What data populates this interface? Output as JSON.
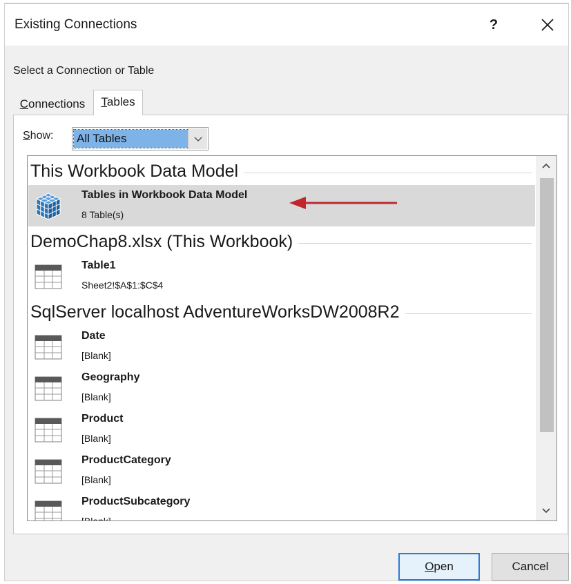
{
  "window": {
    "title": "Existing Connections",
    "help_label": "?",
    "close_label": "✕"
  },
  "prompt": "Select a Connection or Table",
  "tabs": [
    {
      "label_prefix": "",
      "label_underline": "C",
      "label_rest": "onnections",
      "active": false
    },
    {
      "label_prefix": "",
      "label_underline": "T",
      "label_rest": "ables",
      "active": true
    }
  ],
  "show": {
    "label_underline": "S",
    "label_rest": "how:",
    "value": "All Tables"
  },
  "groups": [
    {
      "header": "This Workbook Data Model",
      "items": [
        {
          "name": "Tables in Workbook Data Model",
          "sub": "8 Table(s)",
          "icon": "data-model-cube-icon",
          "selected": true
        }
      ]
    },
    {
      "header": "DemoChap8.xlsx (This Workbook)",
      "items": [
        {
          "name": "Table1",
          "sub": "Sheet2!$A$1:$C$4",
          "icon": "table-icon",
          "selected": false
        }
      ]
    },
    {
      "header": "SqlServer localhost AdventureWorksDW2008R2",
      "items": [
        {
          "name": "Date",
          "sub": "[Blank]",
          "icon": "table-icon",
          "selected": false
        },
        {
          "name": "Geography",
          "sub": "[Blank]",
          "icon": "table-icon",
          "selected": false
        },
        {
          "name": "Product",
          "sub": "[Blank]",
          "icon": "table-icon",
          "selected": false
        },
        {
          "name": "ProductCategory",
          "sub": "[Blank]",
          "icon": "table-icon",
          "selected": false
        },
        {
          "name": "ProductSubcategory",
          "sub": "[Blank]",
          "icon": "table-icon",
          "selected": false
        }
      ]
    }
  ],
  "buttons": {
    "open_underline": "O",
    "open_rest": "pen",
    "cancel": "Cancel"
  },
  "colors": {
    "selection_highlight": "#7eb3e8",
    "selected_row": "#d9d9d9",
    "annotation_arrow": "#c0272d",
    "default_button_border": "#2a7ad6"
  }
}
